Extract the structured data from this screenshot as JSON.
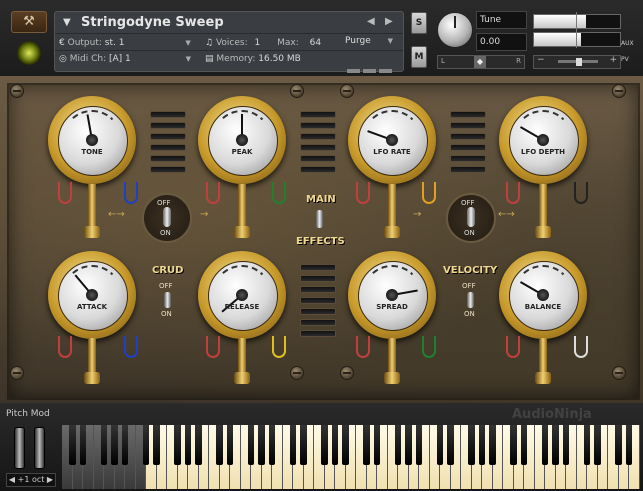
{
  "header": {
    "instrument_name": "Stringodyne Sweep",
    "output_label": "Output:",
    "output_value": "st. 1",
    "voices_label": "Voices:",
    "voices_value": "1",
    "max_label": "Max:",
    "max_value": "64",
    "purge_label": "Purge",
    "midi_label": "Midi Ch:",
    "midi_value": "[A] 1",
    "memory_label": "Memory:",
    "memory_value": "16.50 MB",
    "solo_label": "S",
    "mute_label": "M",
    "tune_label": "Tune",
    "tune_value": "0.00",
    "pan_left": "L",
    "pan_right": "R",
    "aux_label": "AUX",
    "pv_label": "PV",
    "meter_levels": [
      0.6,
      0.55
    ]
  },
  "panel": {
    "gauges": [
      {
        "label": "TONE"
      },
      {
        "label": "PEAK"
      },
      {
        "label": "LFO RATE"
      },
      {
        "label": "LFO DEPTH"
      },
      {
        "label": "ATTACK"
      },
      {
        "label": "RELEASE"
      },
      {
        "label": "SPREAD"
      },
      {
        "label": "BALANCE"
      }
    ],
    "main_label": "MAIN",
    "effects_label": "EFFECTS",
    "crud_label": "CRUD",
    "velocity_label": "VELOCITY",
    "off_label": "OFF",
    "on_label": "ON"
  },
  "keyboard": {
    "pitch_mod_label": "Pitch Mod",
    "octave_value": "+1 oct",
    "watermark": "AudioNinja"
  }
}
